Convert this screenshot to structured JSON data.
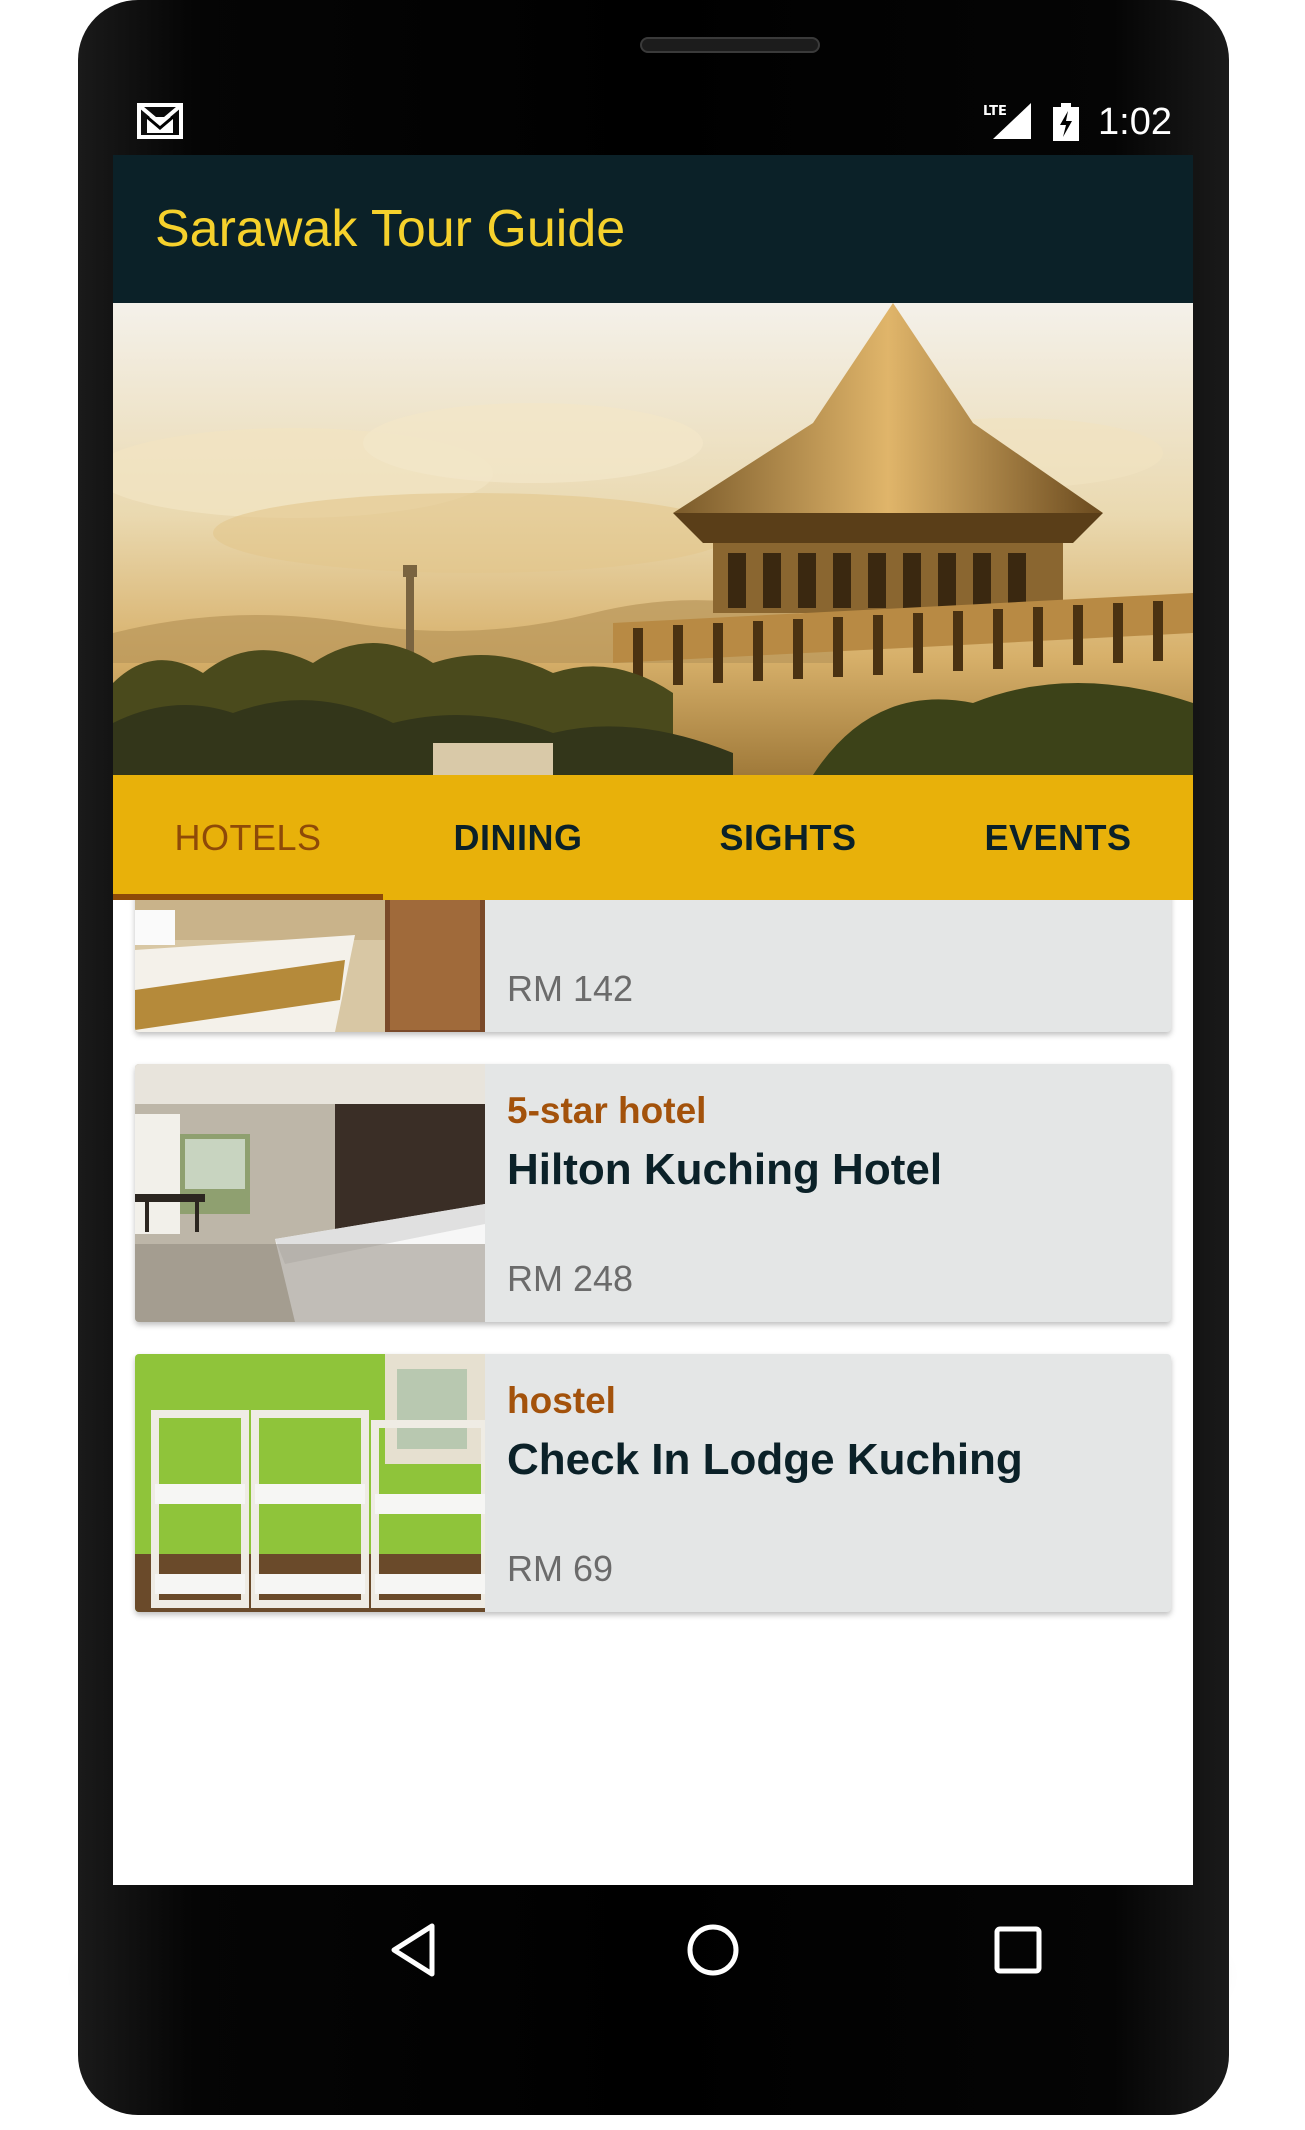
{
  "status_bar": {
    "time": "1:02",
    "network": "LTE",
    "icons": [
      "gmail-icon",
      "lte-signal-icon",
      "battery-charging-icon"
    ]
  },
  "app_bar": {
    "title": "Sarawak Tour Guide"
  },
  "hero": {
    "icon": "sarawak-assembly-building-photo"
  },
  "tabs": [
    {
      "label": "HOTELS",
      "active": true
    },
    {
      "label": "DINING",
      "active": false
    },
    {
      "label": "SIGHTS",
      "active": false
    },
    {
      "label": "EVENTS",
      "active": false
    }
  ],
  "hotels": [
    {
      "type": "",
      "name": "",
      "price": "RM 142"
    },
    {
      "type": "5-star hotel",
      "name": "Hilton Kuching Hotel",
      "price": "RM 248"
    },
    {
      "type": "hostel",
      "name": "Check In Lodge Kuching",
      "price": "RM 69"
    }
  ],
  "nav": {
    "icons": [
      "back-icon",
      "home-icon",
      "recents-icon"
    ]
  },
  "colors": {
    "app_bar": "#0b2128",
    "title": "#f6d12c",
    "tab_bar": "#e8b10a",
    "tab_active": "#8e4a08",
    "hotel_type": "#a3520b",
    "card_bg": "#e4e6e6"
  }
}
